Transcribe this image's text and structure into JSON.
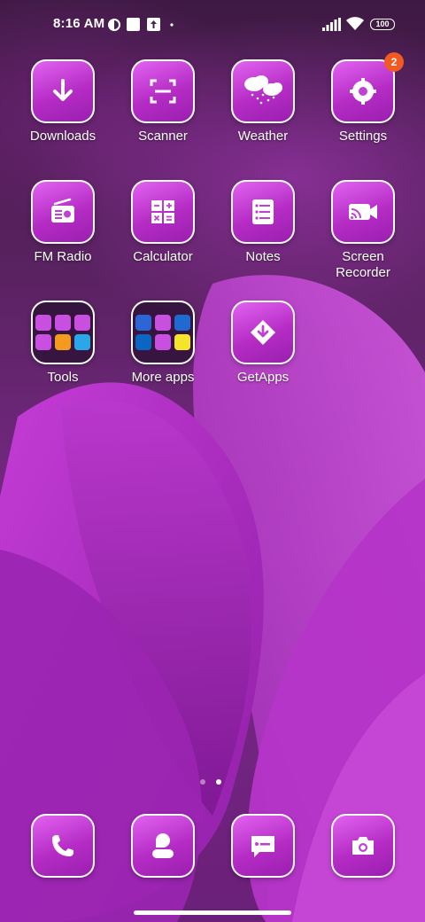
{
  "status_bar": {
    "time": "8:16 AM",
    "battery": "100",
    "icons": [
      "vpn-icon",
      "notification-square-icon",
      "upload-icon",
      "dot-icon",
      "signal-icon",
      "wifi-icon",
      "battery-icon"
    ]
  },
  "apps": [
    {
      "label": "Downloads",
      "icon": "download-icon"
    },
    {
      "label": "Scanner",
      "icon": "scan-icon"
    },
    {
      "label": "Weather",
      "icon": "cloud-rain-icon"
    },
    {
      "label": "Settings",
      "icon": "gear-icon",
      "badge": "2"
    },
    {
      "label": "FM Radio",
      "icon": "radio-icon"
    },
    {
      "label": "Calculator",
      "icon": "calculator-icon"
    },
    {
      "label": "Notes",
      "icon": "notes-icon"
    },
    {
      "label": "Screen Recorder",
      "icon": "screen-recorder-icon"
    },
    {
      "label": "Tools",
      "icon": "folder-icon"
    },
    {
      "label": "More apps",
      "icon": "folder-icon"
    },
    {
      "label": "GetApps",
      "icon": "getapps-icon"
    }
  ],
  "dock": [
    {
      "icon": "phone-icon"
    },
    {
      "icon": "contacts-icon"
    },
    {
      "icon": "messages-icon"
    },
    {
      "icon": "camera-icon"
    }
  ],
  "pager": {
    "pages": 2,
    "active": 2
  },
  "colors": {
    "icon_grad_start": "#e263f0",
    "icon_grad_end": "#9a1faf",
    "badge": "#f15a22"
  }
}
